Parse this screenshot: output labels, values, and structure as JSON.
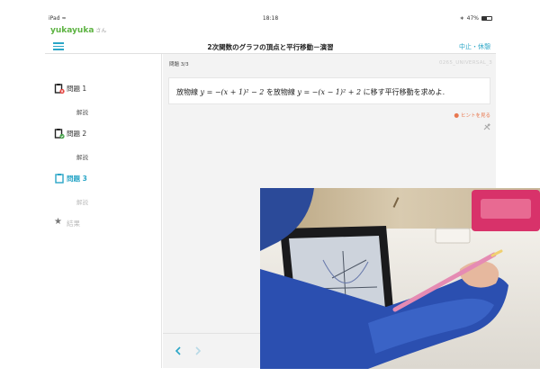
{
  "status_bar": {
    "device": "iPad",
    "time": "18:18",
    "battery": "47%",
    "battery_level": 0.47
  },
  "user": {
    "name": "yukayuka",
    "suffix": "さん"
  },
  "header": {
    "title": "2次関数のグラフの頂点と平行移動－演習",
    "stop_label": "中止・休憩"
  },
  "sidebar": {
    "items": [
      {
        "label": "問題 1",
        "sub": "解説",
        "status": "incorrect",
        "status_color": "#e53935"
      },
      {
        "label": "問題 2",
        "sub": "解説",
        "status": "correct",
        "status_color": "#43a047"
      },
      {
        "label": "問題 3",
        "sub": "解説",
        "status": "current"
      }
    ],
    "result_label": "結果",
    "accent": "#2aa6c7"
  },
  "question": {
    "number": "問題 3/3",
    "code": "0265_UNIVERSAL_3",
    "text_prefix": "放物線 ",
    "expr1": "y = −(x + 1)² − 2",
    "text_middle": " を放物線 ",
    "expr2": "y = −(x − 1)² + 2",
    "text_suffix": " に移す平行移動を求めよ."
  },
  "hint": {
    "label": "ヒントを見る",
    "icon": "lightbulb-icon"
  }
}
